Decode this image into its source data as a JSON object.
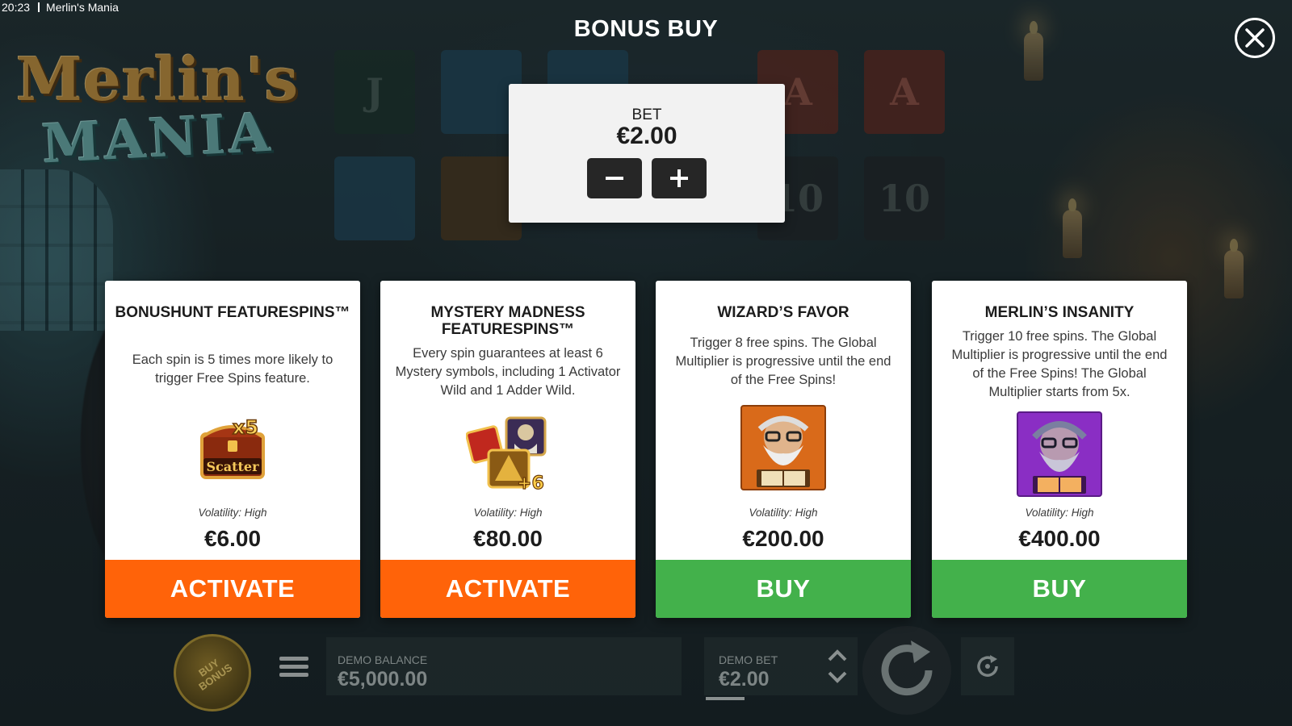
{
  "status_bar": {
    "time": "20:23",
    "app_title": "Merlin's Mania"
  },
  "logo": {
    "line1": "Merlin's",
    "line2": "MANIA"
  },
  "background_reels": [
    "J",
    "A",
    "A",
    "10",
    "10"
  ],
  "modal": {
    "title": "BONUS BUY",
    "close_icon": "close-icon"
  },
  "bet": {
    "label": "BET",
    "value": "€2.00",
    "decrease_icon": "minus-icon",
    "increase_icon": "plus-icon"
  },
  "cards": [
    {
      "title": "BONUSHUNT FEATURESPINS™",
      "description": "Each spin is 5 times more likely to trigger Free Spins feature.",
      "image_icon": "scatter-chest-x5-icon",
      "image_text": [
        "x5",
        "Scatter"
      ],
      "volatility": "Volatility: High",
      "price": "€6.00",
      "button": "ACTIVATE",
      "button_color": "#ff6309"
    },
    {
      "title": "MYSTERY MADNESS FEATURESPINS™",
      "description": "Every spin guarantees at least 6 Mystery symbols, including 1 Activator Wild and 1 Adder Wild.",
      "image_icon": "mystery-symbols-icon",
      "image_text": [
        "+6"
      ],
      "volatility": "Volatility: High",
      "price": "€80.00",
      "button": "ACTIVATE",
      "button_color": "#ff6309"
    },
    {
      "title": "WIZARD’S FAVOR",
      "description": "Trigger 8 free spins. The Global Multiplier is progressive until the end of the Free Spins!",
      "image_icon": "wizard-orange-portrait-icon",
      "volatility": "Volatility: High",
      "price": "€200.00",
      "button": "BUY",
      "button_color": "#43b14b"
    },
    {
      "title": "MERLIN’S INSANITY",
      "description": "Trigger 10 free spins. The Global Multiplier is progressive until the end of the Free Spins! The Global Multiplier starts from 5x.",
      "image_icon": "wizard-purple-portrait-icon",
      "volatility": "Volatility: High",
      "price": "€400.00",
      "button": "BUY",
      "button_color": "#43b14b"
    }
  ],
  "bottom_bar": {
    "buy_bonus": "BUY BONUS",
    "balance_label": "DEMO BALANCE",
    "balance_value": "€5,000.00",
    "bet_label": "DEMO BET",
    "bet_value": "€2.00",
    "menu_icon": "hamburger-menu-icon",
    "bet_adjust_icon": "chevron-up-down-icon",
    "spin_icon": "spin-arrow-icon",
    "autoplay_icon": "autoplay-icon"
  }
}
